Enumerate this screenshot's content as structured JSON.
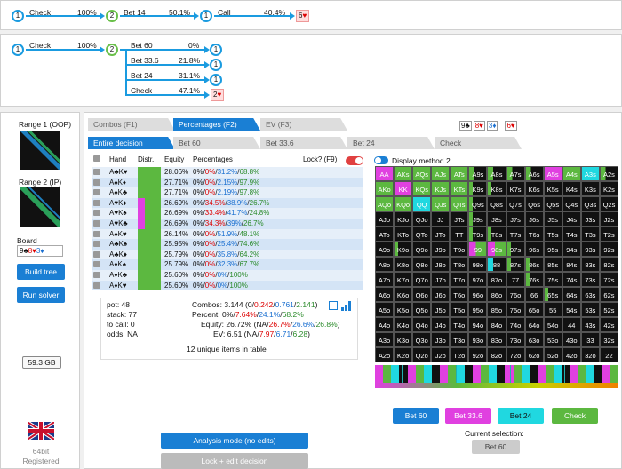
{
  "tree1": {
    "nodes": [
      "1",
      "2",
      "1"
    ],
    "edges": [
      {
        "label": "Check",
        "pct": "100%"
      },
      {
        "label": "Bet 14",
        "pct": "50.1%"
      },
      {
        "label": "Call",
        "pct": "40.4%"
      }
    ],
    "end_label": "6"
  },
  "tree2": {
    "nodes": [
      "1",
      "2"
    ],
    "root_edge": {
      "label": "Check",
      "pct": "100%"
    },
    "branches": [
      {
        "label": "Bet 60",
        "pct": "0%",
        "node": "1"
      },
      {
        "label": "Bet 33.6",
        "pct": "21.8%",
        "node": "1"
      },
      {
        "label": "Bet 24",
        "pct": "31.1%",
        "node": "1"
      },
      {
        "label": "Check",
        "pct": "47.1%",
        "node": "2"
      }
    ]
  },
  "left": {
    "range1_label": "Range 1 (OOP)",
    "range2_label": "Range 2 (IP)",
    "board_label": "Board",
    "board_cards": [
      "9♣",
      "8♥",
      "3♦"
    ],
    "build_tree": "Build tree",
    "run_solver": "Run solver",
    "memory": "59.3 GB",
    "bit_text": "64bit",
    "registered": "Registered"
  },
  "tabs_row1": [
    "Combos (F1)",
    "Percentages (F2)",
    "EV (F3)"
  ],
  "board_display": [
    "9♣",
    "8♥",
    "3♦",
    "6♥"
  ],
  "tabs_row2": [
    "Entire decision",
    "Bet 60",
    "Bet 33.6",
    "Bet 24",
    "Check"
  ],
  "hand_table": {
    "headers": [
      "Hand",
      "Distr.",
      "Equity",
      "Percentages"
    ],
    "lock_label": "Lock? (F9)",
    "rows": [
      {
        "hand": "A♣K♥",
        "equity": "28.06%",
        "p": [
          "0%",
          "0%",
          "31.2%",
          "68.8%"
        ]
      },
      {
        "hand": "A♠K♦",
        "equity": "27.71%",
        "p": [
          "0%",
          "0%",
          "2.15%",
          "97.9%"
        ]
      },
      {
        "hand": "A♠K♣",
        "equity": "27.71%",
        "p": [
          "0%",
          "0%",
          "2.19%",
          "97.8%"
        ]
      },
      {
        "hand": "A♥K♦",
        "equity": "26.69%",
        "p": [
          "0%",
          "34.5%",
          "38.9%",
          "26.7%"
        ]
      },
      {
        "hand": "A♥K♠",
        "equity": "26.69%",
        "p": [
          "0%",
          "33.4%",
          "41.7%",
          "24.8%"
        ]
      },
      {
        "hand": "A♥K♣",
        "equity": "26.69%",
        "p": [
          "0%",
          "34.3%",
          "39%",
          "26.7%"
        ]
      },
      {
        "hand": "A♠K♥",
        "equity": "26.14%",
        "p": [
          "0%",
          "0%",
          "51.9%",
          "48.1%"
        ]
      },
      {
        "hand": "A♣K♠",
        "equity": "25.95%",
        "p": [
          "0%",
          "0%",
          "25.4%",
          "74.6%"
        ]
      },
      {
        "hand": "A♣K♦",
        "equity": "25.79%",
        "p": [
          "0%",
          "0%",
          "35.8%",
          "64.2%"
        ]
      },
      {
        "hand": "A♦K♠",
        "equity": "25.79%",
        "p": [
          "0%",
          "0%",
          "32.3%",
          "67.7%"
        ]
      },
      {
        "hand": "A♦K♣",
        "equity": "25.60%",
        "p": [
          "0%",
          "0%",
          "0%",
          "100%"
        ]
      },
      {
        "hand": "A♦K♥",
        "equity": "25.60%",
        "p": [
          "0%",
          "0%",
          "0%",
          "100%"
        ]
      }
    ]
  },
  "stats": {
    "pot": "pot: 48",
    "stack": "stack: 77",
    "to_call": "to call: 0",
    "odds": "odds: NA",
    "combos_label": "Combos:",
    "combos_total": "3.144",
    "combos_parts": [
      "0",
      "0.242",
      "0.761",
      "2.141"
    ],
    "percent_label": "Percent:",
    "percent_parts": [
      "0%",
      "7.64%",
      "24.1%",
      "68.2%"
    ],
    "equity_label": "Equity:",
    "equity_total": "26.72%",
    "equity_parts": [
      "NA",
      "26.7%",
      "26.6%",
      "26.8%"
    ],
    "ev_label": "EV:",
    "ev_total": "6.51",
    "ev_parts": [
      "NA",
      "7.97",
      "6.71",
      "6.28"
    ],
    "unique": "12 unique items in table"
  },
  "display_method": "Display method 2",
  "grid": {
    "ranks": [
      "A",
      "K",
      "Q",
      "J",
      "T",
      "9",
      "8",
      "7",
      "6",
      "5",
      "4",
      "3",
      "2"
    ]
  },
  "action_buttons": [
    {
      "label": "Bet 60",
      "color": "#1a7fd4"
    },
    {
      "label": "Bet 33.6",
      "color": "#e040e0"
    },
    {
      "label": "Bet 24",
      "color": "#20d8e0"
    },
    {
      "label": "Check",
      "color": "#5cb840"
    }
  ],
  "current_selection_label": "Current selection:",
  "current_selection_value": "Bet 60",
  "analysis_mode": "Analysis mode (no edits)",
  "lock_edit": "Lock + edit decision"
}
